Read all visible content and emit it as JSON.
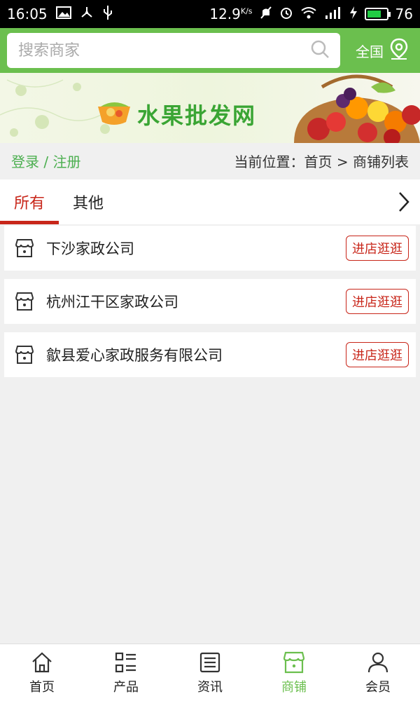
{
  "status": {
    "time": "16:05",
    "speed": "12.9",
    "speed_unit": "K/s",
    "battery": "76",
    "battery_pct": 76
  },
  "search": {
    "placeholder": "搜索商家"
  },
  "region": {
    "label": "全国"
  },
  "banner": {
    "title": "水果批发网"
  },
  "crumb": {
    "login": "登录 / 注册",
    "location": "当前位置：首页 > 商铺列表"
  },
  "tabs": [
    {
      "label": "所有",
      "active": true
    },
    {
      "label": "其他",
      "active": false
    }
  ],
  "stores": [
    {
      "name": "下沙家政公司",
      "action": "进店逛逛"
    },
    {
      "name": "杭州江干区家政公司",
      "action": "进店逛逛"
    },
    {
      "name": "歙县爱心家政服务有限公司",
      "action": "进店逛逛"
    }
  ],
  "nav": [
    {
      "label": "首页",
      "icon": "home-icon"
    },
    {
      "label": "产品",
      "icon": "product-icon"
    },
    {
      "label": "资讯",
      "icon": "news-icon"
    },
    {
      "label": "商铺",
      "icon": "store-icon",
      "active": true
    },
    {
      "label": "会员",
      "icon": "user-icon"
    }
  ],
  "colors": {
    "brand": "#6bbf4e",
    "accent": "#c8261a"
  }
}
